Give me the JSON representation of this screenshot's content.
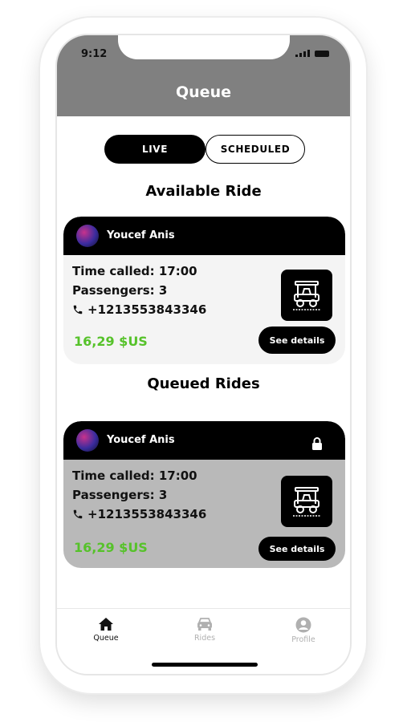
{
  "status_bar": {
    "time": "9:12"
  },
  "header": {
    "title": "Queue"
  },
  "tabs": [
    {
      "label": "LIVE",
      "active": true
    },
    {
      "label": "SCHEDULED",
      "active": false
    }
  ],
  "available": {
    "section_title": "Available Ride",
    "card": {
      "driver_name": "Youcef Anis",
      "time_called": "Time called: 17:00",
      "passengers": "Passengers: 3",
      "phone": "+1213553843346",
      "price": "16,29 $US",
      "details_label": "See details",
      "locked": false
    }
  },
  "queued": {
    "section_title": "Queued Rides",
    "card": {
      "driver_name": "Youcef Anis",
      "time_called": "Time called: 17:00",
      "passengers": "Passengers: 3",
      "phone": "+1213553843346",
      "price": "16,29 $US",
      "details_label": "See details",
      "locked": true
    }
  },
  "nav": [
    {
      "label": "Queue",
      "icon": "home-icon",
      "active": true
    },
    {
      "label": "Rides",
      "icon": "car-icon",
      "active": false
    },
    {
      "label": "Profile",
      "icon": "profile-icon",
      "active": false
    }
  ],
  "colors": {
    "header_bg": "#808080",
    "price_green": "#56c22a",
    "card_body_available": "#f4f4f4",
    "card_body_queued": "#b9b9b9"
  }
}
